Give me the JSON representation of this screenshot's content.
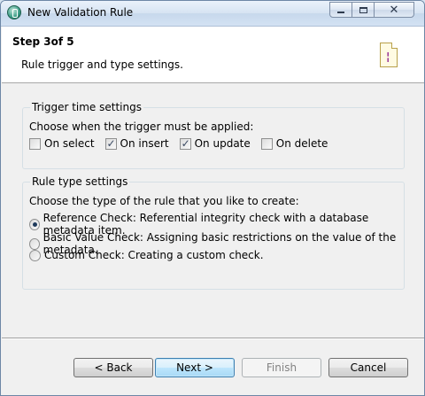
{
  "window": {
    "title": "New Validation Rule",
    "controls": {
      "minimize": "minimize-icon",
      "maximize": "maximize-icon",
      "close": "close-icon"
    }
  },
  "header": {
    "step": "Step 3of 5",
    "description": "Rule trigger and type settings.",
    "icon": "document-icon"
  },
  "trigger_group": {
    "title": "Trigger time settings",
    "prompt": "Choose when the trigger must be applied:",
    "options": [
      {
        "label": "On select",
        "checked": false
      },
      {
        "label": "On insert",
        "checked": true
      },
      {
        "label": "On update",
        "checked": true
      },
      {
        "label": "On delete",
        "checked": false
      }
    ]
  },
  "rule_group": {
    "title": "Rule type settings",
    "prompt": "Choose the type of the rule that you like to create:",
    "options": [
      {
        "label": "Reference Check: Referential integrity check with a database metadata item.",
        "selected": true
      },
      {
        "label": "Basic Value Check: Assigning basic restrictions on the value of the metadata.",
        "selected": false
      },
      {
        "label": "Custom Check: Creating a custom check.",
        "selected": false
      }
    ]
  },
  "buttons": {
    "back": "< Back",
    "next": "Next >",
    "finish": "Finish",
    "cancel": "Cancel"
  }
}
